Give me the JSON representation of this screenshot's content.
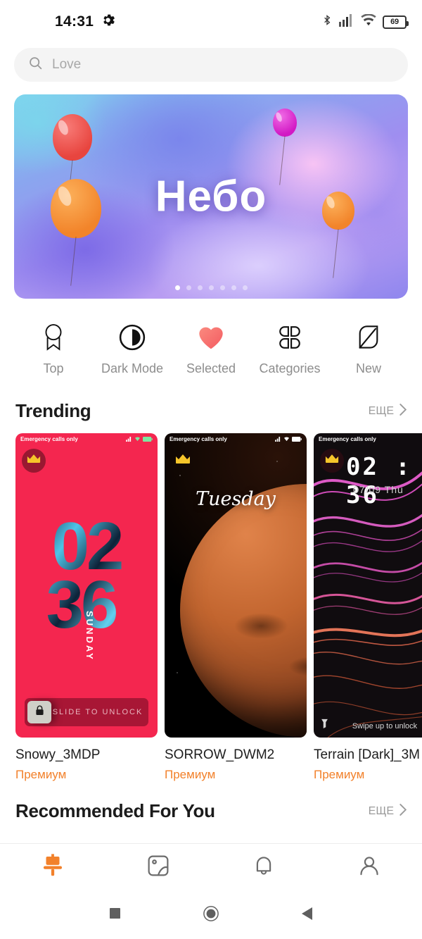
{
  "statusbar": {
    "time": "14:31",
    "gear_icon": "gear-icon",
    "bluetooth_icon": "bluetooth-icon",
    "signal_icon": "cellular-signal-icon",
    "wifi_icon": "wifi-icon",
    "battery_level": "69"
  },
  "search": {
    "placeholder": "Love",
    "icon": "search-icon"
  },
  "banner": {
    "title": "Небо",
    "dots_total": 7,
    "active_dot": 1
  },
  "categories": [
    {
      "label": "Top",
      "icon": "medal-icon"
    },
    {
      "label": "Dark Mode",
      "icon": "contrast-icon"
    },
    {
      "label": "Selected",
      "icon": "heart-icon"
    },
    {
      "label": "Categories",
      "icon": "four-petals-icon"
    },
    {
      "label": "New",
      "icon": "leaf-icon"
    }
  ],
  "sections": {
    "trending": {
      "title": "Trending",
      "more_label": "ЕЩЕ",
      "more_icon": "chevron-right-icon"
    },
    "recommended": {
      "title": "Recommended For You",
      "more_label": "ЕЩЕ",
      "more_icon": "chevron-right-icon"
    }
  },
  "wallpapers": [
    {
      "title": "Snowy_3MDP",
      "tag": "Премиум",
      "badge_icon": "crown-icon",
      "status_text": "Emergency calls only",
      "clock_line1": "02",
      "clock_line2": "36",
      "day": "SUNDAY",
      "unlock_text": "SLIDE TO UNLOCK",
      "lock_icon": "lock-icon"
    },
    {
      "title": "SORROW_DWM2",
      "tag": "Премиум",
      "badge_icon": "crown-icon",
      "status_text": "Emergency calls only",
      "day": "Tuesday"
    },
    {
      "title": "Terrain [Dark]_3M",
      "tag": "Премиум",
      "badge_icon": "crown-icon",
      "status_text": "Emergency calls only",
      "clock": "02 : 36",
      "date": "07/09 Thu",
      "unlock_text": "Swipe up to unlock",
      "flash_icon": "flashlight-icon"
    }
  ],
  "bottom_nav": [
    {
      "name": "wallpapers",
      "icon": "paint-roller-icon",
      "active": true
    },
    {
      "name": "gallery",
      "icon": "image-icon",
      "active": false
    },
    {
      "name": "notifications",
      "icon": "bell-icon",
      "active": false
    },
    {
      "name": "profile",
      "icon": "person-icon",
      "active": false
    }
  ],
  "system_nav": [
    {
      "name": "recents",
      "icon": "square-icon"
    },
    {
      "name": "home",
      "icon": "circle-icon"
    },
    {
      "name": "back",
      "icon": "triangle-back-icon"
    }
  ],
  "colors": {
    "accent": "#f2812b",
    "heart": "#f9706d",
    "card1_bg": "#f4264f"
  }
}
